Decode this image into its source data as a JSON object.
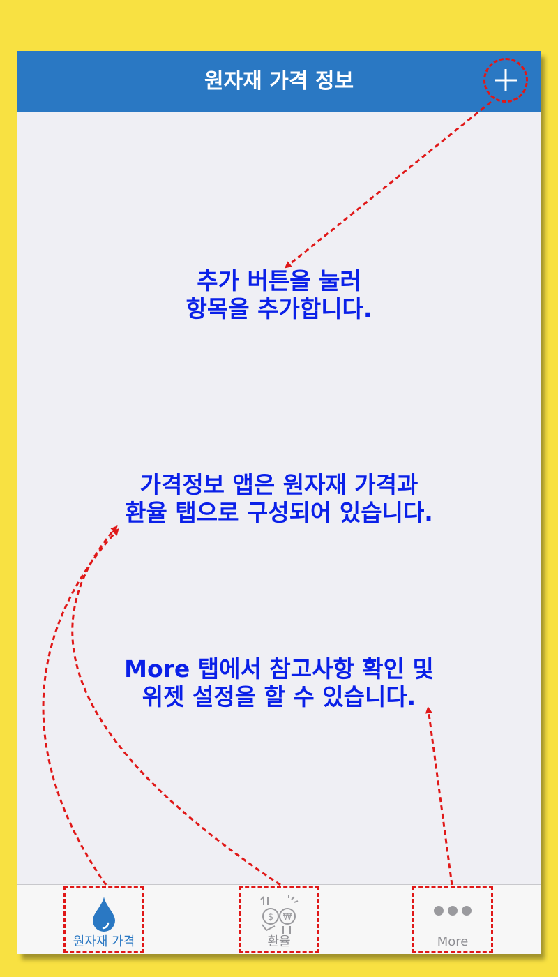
{
  "navbar": {
    "title": "원자재 가격 정보",
    "add_icon": "plus-icon"
  },
  "hints": {
    "add_hint": [
      "추가 버튼을 눌러",
      "항목을 추가합니다."
    ],
    "tabs_hint": [
      "가격정보 앱은 원자재 가격과",
      "환율 탭으로 구성되어 있습니다."
    ],
    "more_hint": [
      "More 탭에서 참고사항 확인 및",
      "위젯 설정을 할 수 있습니다."
    ]
  },
  "tabbar": {
    "tabs": [
      {
        "label": "원자재 가격",
        "icon": "water-drop-icon",
        "active": true
      },
      {
        "label": "환율",
        "icon": "currency-exchange-icon",
        "active": false
      },
      {
        "label": "More",
        "icon": "more-dots-icon",
        "active": false
      }
    ]
  },
  "colors": {
    "background": "#f8e142",
    "navbar": "#2a78c3",
    "hint_text": "#0a20e8",
    "annotation": "#e01818",
    "tab_active": "#2a78c3",
    "tab_inactive": "#8e8e93"
  }
}
